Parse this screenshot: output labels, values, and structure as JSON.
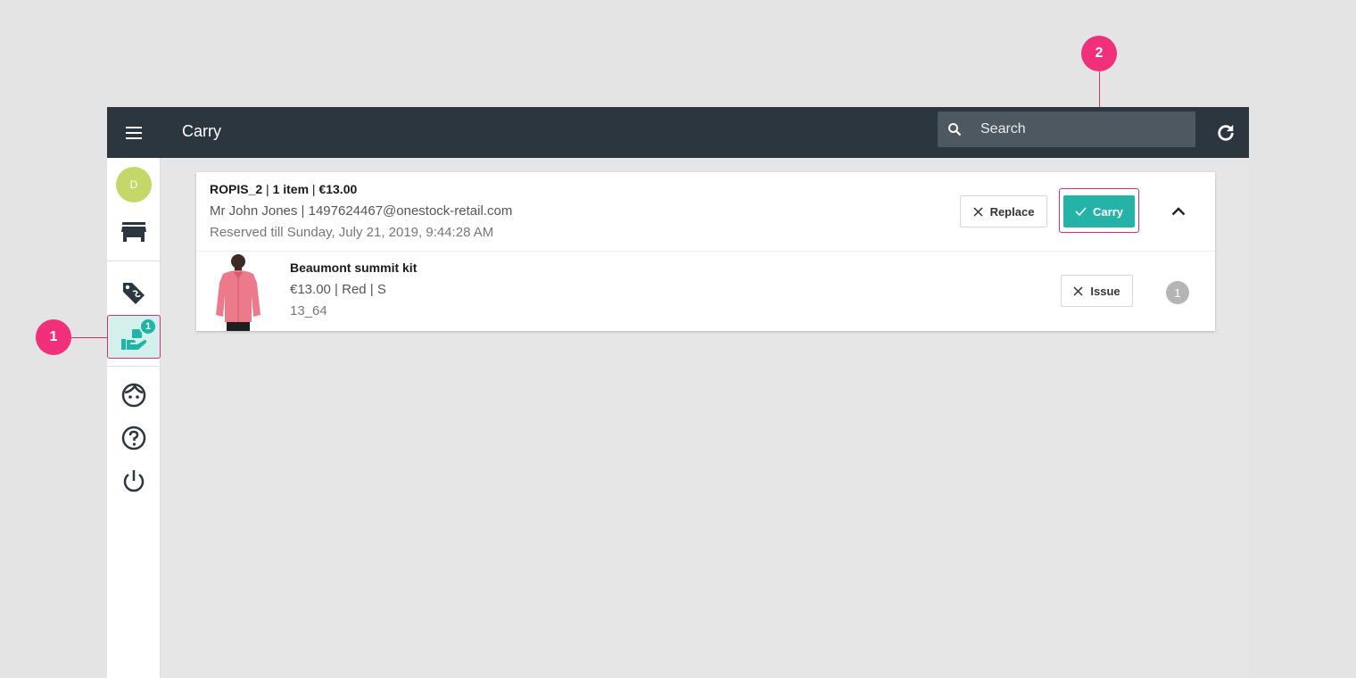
{
  "topbar": {
    "title": "Carry",
    "search_placeholder": "Search",
    "menu_icon": "hamburger-menu-icon",
    "refresh_icon": "refresh-icon"
  },
  "sidebar": {
    "avatar_initial": "D",
    "items": [
      {
        "name": "store",
        "icon": "store-icon"
      },
      {
        "name": "tags",
        "icon": "tags-icon"
      },
      {
        "name": "carry",
        "icon": "hand-parcel-icon",
        "badge": "1",
        "active": true
      },
      {
        "name": "profile",
        "icon": "face-icon"
      },
      {
        "name": "help",
        "icon": "help-icon"
      },
      {
        "name": "logout",
        "icon": "power-icon"
      }
    ]
  },
  "order": {
    "reference": "ROPIS_2",
    "sep": " | ",
    "items_count": "1 item",
    "total": "€13.00",
    "customer_line": "Mr John Jones | 1497624467@onestock-retail.com",
    "reserved_line": "Reserved till Sunday, July 21, 2019, 9:44:28 AM",
    "replace_label": "Replace",
    "carry_label": "Carry"
  },
  "product": {
    "name": "Beaumont summit kit",
    "meta": "€13.00 | Red | S",
    "ref": "13_64",
    "issue_label": "Issue",
    "quantity": "1"
  },
  "callouts": {
    "one": "1",
    "two": "2"
  },
  "colors": {
    "topbar": "#2c363e",
    "accent": "#26b3a7",
    "callout": "#f0307a",
    "avatar": "#c4d86a"
  }
}
